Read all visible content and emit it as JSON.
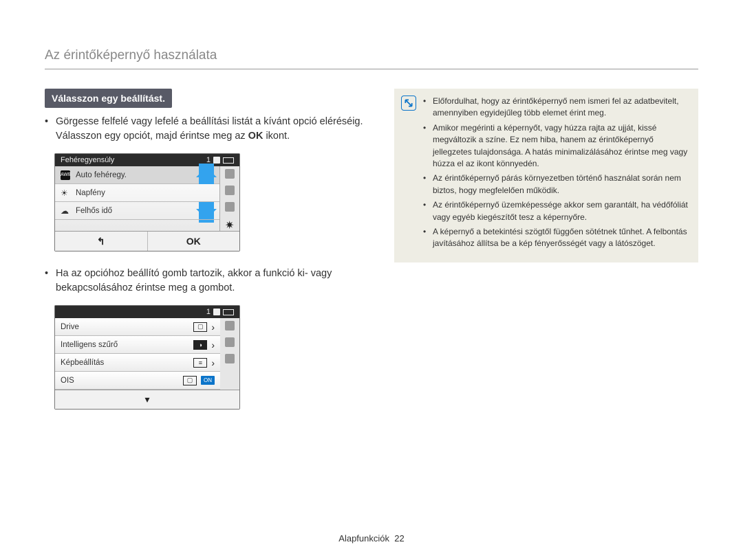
{
  "page": {
    "title": "Az érintőképernyő használata",
    "footer_section": "Alapfunkciók",
    "footer_page": "22"
  },
  "left": {
    "subheader": "Válasszon egy beállítást.",
    "para1_pre": "Görgesse felfelé vagy lefelé a beállítási listát a kívánt opció eléréséig. Válasszon egy opciót, majd érintse meg az ",
    "para1_ok": "OK",
    "para1_post": " ikont.",
    "para2": "Ha az opcióhoz beállító gomb tartozik, akkor a funkció ki- vagy bekapcsolásához érintse meg a gombot."
  },
  "shot1": {
    "header_title": "Fehéregyensúly",
    "header_count": "1",
    "rows": [
      {
        "icon": "awb",
        "label": "Auto fehéregy."
      },
      {
        "icon": "sun",
        "label": "Napfény"
      },
      {
        "icon": "cloud",
        "label": "Felhős idő"
      }
    ],
    "ok_label": "OK"
  },
  "shot2": {
    "header_count": "1",
    "rows": [
      {
        "label": "Drive",
        "value_icon": "box",
        "chevron": true
      },
      {
        "label": "Intelligens szűrő",
        "value_icon": "shutter",
        "chevron": true
      },
      {
        "label": "Képbeállítás",
        "value_icon": "sliders",
        "chevron": true
      },
      {
        "label": "OIS",
        "value_icon": "box",
        "on": true
      }
    ]
  },
  "notes": {
    "items": [
      "Előfordulhat, hogy az érintőképernyő nem ismeri fel az adatbevitelt, amennyiben egyidejűleg több elemet érint meg.",
      "Amikor megérinti a képernyőt, vagy húzza rajta az ujját, kissé megváltozik a színe. Ez nem hiba, hanem az érintőképernyő jellegzetes tulajdonsága. A hatás minimalizálásához érintse meg vagy húzza el az ikont könnyedén.",
      "Az érintőképernyő párás környezetben történő használat során nem biztos, hogy megfelelően működik.",
      "Az érintőképernyő üzemképessége akkor sem garantált, ha védőfóliát vagy egyéb kiegészítőt tesz a képernyőre.",
      "A képernyő a betekintési szögtől függően sötétnek tűnhet. A felbontás javításához állítsa be a kép fényerősségét vagy a látószöget."
    ]
  }
}
